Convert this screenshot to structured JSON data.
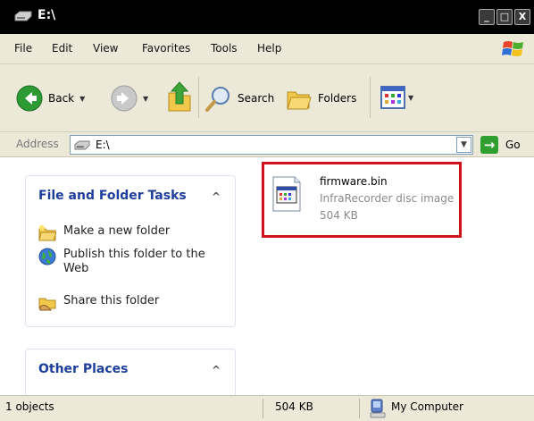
{
  "window": {
    "title": "E:\\"
  },
  "menu": [
    "File",
    "Edit",
    "View",
    "Favorites",
    "Tools",
    "Help"
  ],
  "toolbar": {
    "back_label": "Back",
    "search_label": "Search",
    "folders_label": "Folders"
  },
  "address": {
    "label": "Address",
    "value": "E:\\",
    "go_label": "Go"
  },
  "tasks_panel": {
    "title": "File and Folder Tasks",
    "items": [
      {
        "label": "Make a new folder",
        "icon": "new-folder-icon"
      },
      {
        "label": "Publish this folder to the Web",
        "icon": "globe-icon"
      },
      {
        "label": "Share this folder",
        "icon": "share-folder-icon"
      }
    ]
  },
  "places_panel": {
    "title": "Other Places"
  },
  "file": {
    "name": "firmware.bin",
    "type": "InfraRecorder disc image",
    "size": "504 KB"
  },
  "status": {
    "objects": "1 objects",
    "size": "504 KB",
    "location": "My Computer"
  },
  "colors": {
    "accent_link": "#1d3f9b",
    "highlight_border": "#d0121b",
    "chrome": "#ece9d8"
  }
}
